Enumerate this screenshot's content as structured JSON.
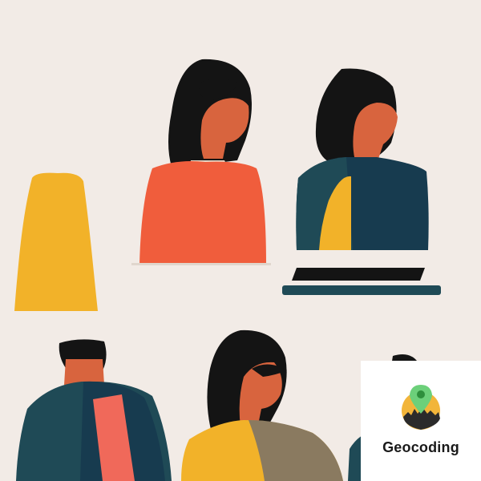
{
  "badge": {
    "label": "Geocoding",
    "icon": "map-pin-icon",
    "pin_color": "#6cd07a",
    "sun_color": "#f2b53a",
    "skyline_color": "#2b2b2b"
  },
  "colors": {
    "background": "#f2ebe6",
    "hair": "#141414",
    "skin": "#d8643e",
    "orange_shirt": "#f05d3c",
    "yellow": "#f2b229",
    "teal": "#1f4a56",
    "navy": "#173b4f",
    "coral": "#f0695a",
    "olive": "#8a7a60"
  }
}
